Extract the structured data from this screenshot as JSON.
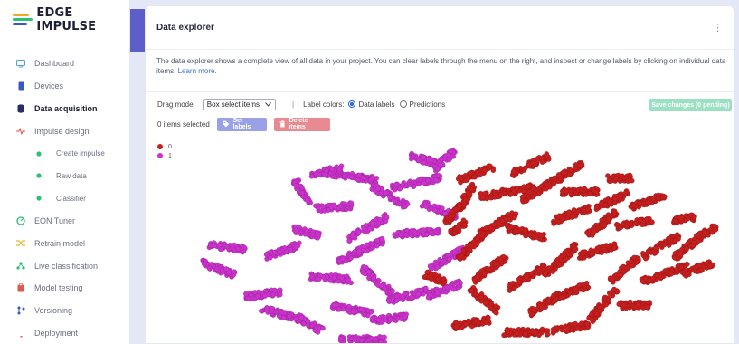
{
  "brand": {
    "name": "EDGE IMPULSE"
  },
  "sidebar": {
    "items": [
      {
        "label": "Dashboard",
        "icon": "monitor-icon",
        "active": false,
        "sub": false,
        "color": "#4f9fd6"
      },
      {
        "label": "Devices",
        "icon": "device-icon",
        "active": false,
        "sub": false,
        "color": "#3a57c2"
      },
      {
        "label": "Data acquisition",
        "icon": "database-icon",
        "active": true,
        "sub": false,
        "color": "#2a2c6a"
      },
      {
        "label": "Impulse design",
        "icon": "pulse-icon",
        "active": false,
        "sub": false,
        "color": "#e2574c"
      },
      {
        "label": "Create impulse",
        "icon": "dot-icon",
        "active": false,
        "sub": true,
        "color": "#2fbf71"
      },
      {
        "label": "Raw data",
        "icon": "dot-icon",
        "active": false,
        "sub": true,
        "color": "#2fbf71"
      },
      {
        "label": "Classifier",
        "icon": "dot-icon",
        "active": false,
        "sub": true,
        "color": "#2fbf71"
      },
      {
        "label": "EON Tuner",
        "icon": "tuner-icon",
        "active": false,
        "sub": false,
        "color": "#2fbf71"
      },
      {
        "label": "Retrain model",
        "icon": "shuffle-icon",
        "active": false,
        "sub": false,
        "color": "#f0b429"
      },
      {
        "label": "Live classification",
        "icon": "network-icon",
        "active": false,
        "sub": false,
        "color": "#2fbf71"
      },
      {
        "label": "Model testing",
        "icon": "clipboard-icon",
        "active": false,
        "sub": false,
        "color": "#e2574c"
      },
      {
        "label": "Versioning",
        "icon": "branch-icon",
        "active": false,
        "sub": false,
        "color": "#3a57c2"
      },
      {
        "label": "Deployment",
        "icon": "rocket-icon",
        "active": false,
        "sub": false,
        "color": "#e2574c"
      }
    ]
  },
  "panel": {
    "title": "Data explorer",
    "description": "The data explorer shows a complete view of all data in your project. You can clear labels through the menu on the right, and inspect or change labels by clicking on individual data items.",
    "learn_more": "Learn more.",
    "drag_mode_label": "Drag mode:",
    "drag_mode_value": "Box select items",
    "label_colors_label": "Label colors:",
    "radio_data_labels": "Data labels",
    "radio_predictions": "Predictions",
    "save_button": "Save changes (0 pending)",
    "items_selected": "0 items selected",
    "set_labels_button": "Set labels",
    "delete_items_button": "Delete items"
  },
  "chart_data": {
    "type": "scatter",
    "legend": [
      {
        "name": "0",
        "color": "#c61f1f"
      },
      {
        "name": "1",
        "color": "#cc33cc"
      }
    ],
    "legend_position": "top-left",
    "axes_labels": false,
    "grid": false
  }
}
